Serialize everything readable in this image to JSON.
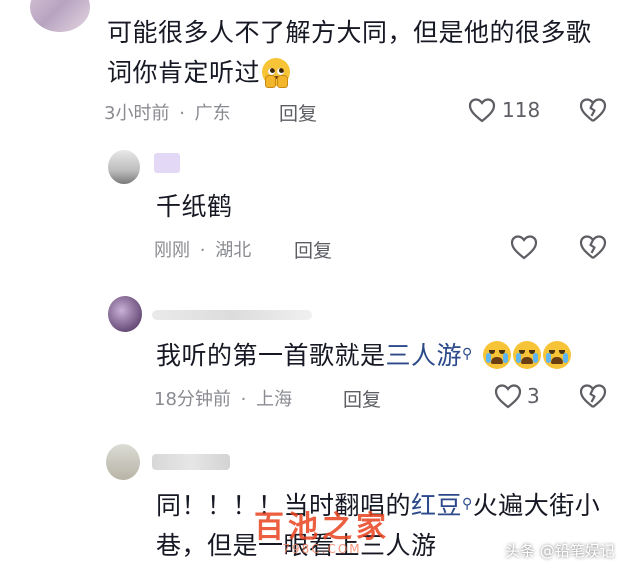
{
  "comments": [
    {
      "text_lines": [
        "可能很多人不了解方大同，但是他的很多歌",
        "词你肯定听过"
      ],
      "emoji_icon": "pleading-face-icon",
      "time": "3小时前",
      "location": "广东",
      "reply_label": "回复",
      "like_count": "118"
    },
    {
      "text": "千纸鹤",
      "time": "刚刚",
      "location": "湖北",
      "reply_label": "回复",
      "like_count": ""
    },
    {
      "text_before": "我听的第一首歌就是",
      "link_text": "三人游",
      "emoji_icons": [
        "crying-face-icon",
        "crying-face-icon",
        "crying-face-icon"
      ],
      "time": "18分钟前",
      "location": "上海",
      "reply_label": "回复",
      "like_count": "3"
    },
    {
      "line1_before": "同！！！！当时翻唱的",
      "link_text": "红豆",
      "line1_after": "火遍大街小",
      "line2": "巷，但是一眼看上三人游"
    }
  ],
  "separator": "·",
  "watermark": {
    "main": "百池之家",
    "sub": "798C.COM"
  },
  "attribution": "头条 @铅笔娱记",
  "colors": {
    "link": "#2c4a8a",
    "meta": "#8a8b91",
    "watermark": "#e8431f"
  }
}
